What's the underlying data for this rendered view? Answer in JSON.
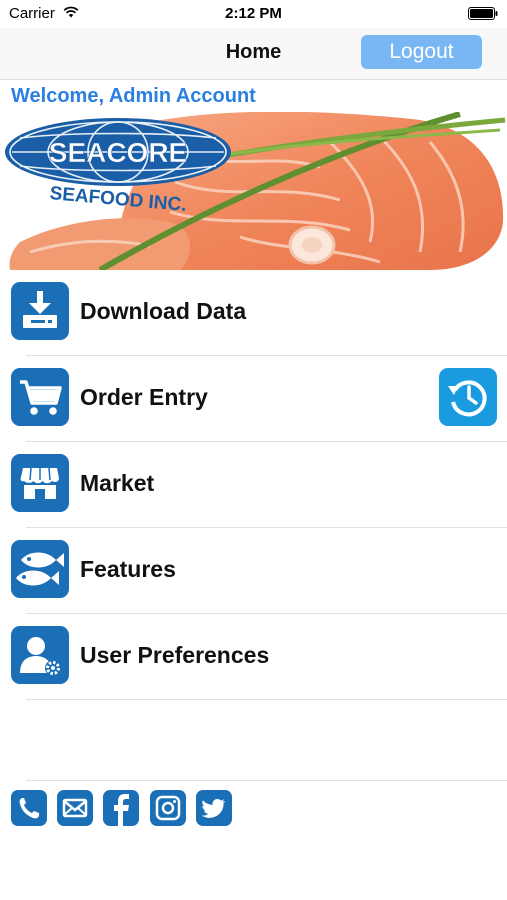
{
  "status_bar": {
    "carrier": "Carrier",
    "time": "2:12 PM"
  },
  "nav": {
    "title": "Home",
    "logout_label": "Logout"
  },
  "welcome": "Welcome, Admin Account",
  "banner": {
    "brand": "SEACORE",
    "tagline": "SEAFOOD INC."
  },
  "menu": [
    {
      "label": "Download Data",
      "icon": "download-icon"
    },
    {
      "label": "Order Entry",
      "icon": "cart-icon",
      "side_icon": "history-icon"
    },
    {
      "label": "Market",
      "icon": "store-icon"
    },
    {
      "label": "Features",
      "icon": "fish-icon"
    },
    {
      "label": "User Preferences",
      "icon": "user-settings-icon"
    }
  ],
  "social": [
    "phone-icon",
    "mail-icon",
    "facebook-icon",
    "instagram-icon",
    "twitter-icon"
  ],
  "colors": {
    "accent": "#2a7fe0",
    "icon_bg": "#1a6fb7",
    "history_bg": "#1a9be0",
    "logout_bg": "#79b7f4"
  }
}
